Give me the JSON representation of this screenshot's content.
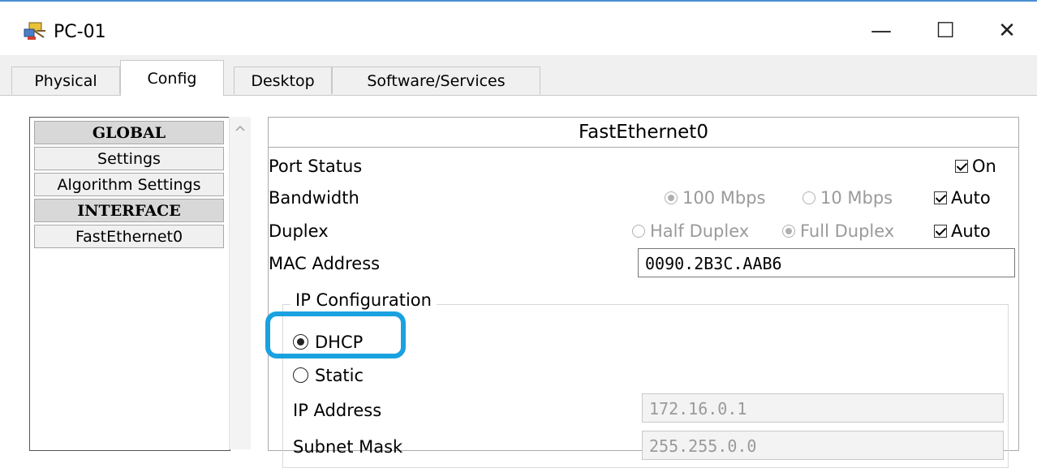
{
  "window": {
    "title": "PC-01",
    "minimize_glyph": "—",
    "maximize_glyph": "☐",
    "close_glyph": "✕",
    "icon": "pc-icon"
  },
  "tabs": [
    {
      "label": "Physical",
      "active": false
    },
    {
      "label": "Config",
      "active": true
    },
    {
      "label": "Desktop",
      "active": false
    },
    {
      "label": "Software/Services",
      "active": false
    }
  ],
  "sidebar": {
    "items": [
      {
        "label": "GLOBAL",
        "header": true
      },
      {
        "label": "Settings",
        "header": false
      },
      {
        "label": "Algorithm Settings",
        "header": false
      },
      {
        "label": "INTERFACE",
        "header": true
      },
      {
        "label": "FastEthernet0",
        "header": false
      }
    ]
  },
  "interface": {
    "title": "FastEthernet0",
    "port_status": {
      "label": "Port Status",
      "on_label": "On",
      "checked": true
    },
    "bandwidth": {
      "label": "Bandwidth",
      "option1": "100 Mbps",
      "option2": "10 Mbps",
      "auto_label": "Auto",
      "auto_checked": true
    },
    "duplex": {
      "label": "Duplex",
      "option1": "Half Duplex",
      "option2": "Full Duplex",
      "auto_label": "Auto",
      "auto_checked": true
    },
    "mac": {
      "label": "MAC Address",
      "value": "0090.2B3C.AAB6"
    },
    "ip_config": {
      "title": "IP Configuration",
      "dhcp_label": "DHCP",
      "static_label": "Static",
      "selected": "DHCP",
      "ip_label": "IP Address",
      "ip_value": "172.16.0.1",
      "mask_label": "Subnet Mask",
      "mask_value": "255.255.0.0"
    }
  },
  "colors": {
    "highlight": "#1aa1e0",
    "title_accent": "#4a8fd6"
  }
}
